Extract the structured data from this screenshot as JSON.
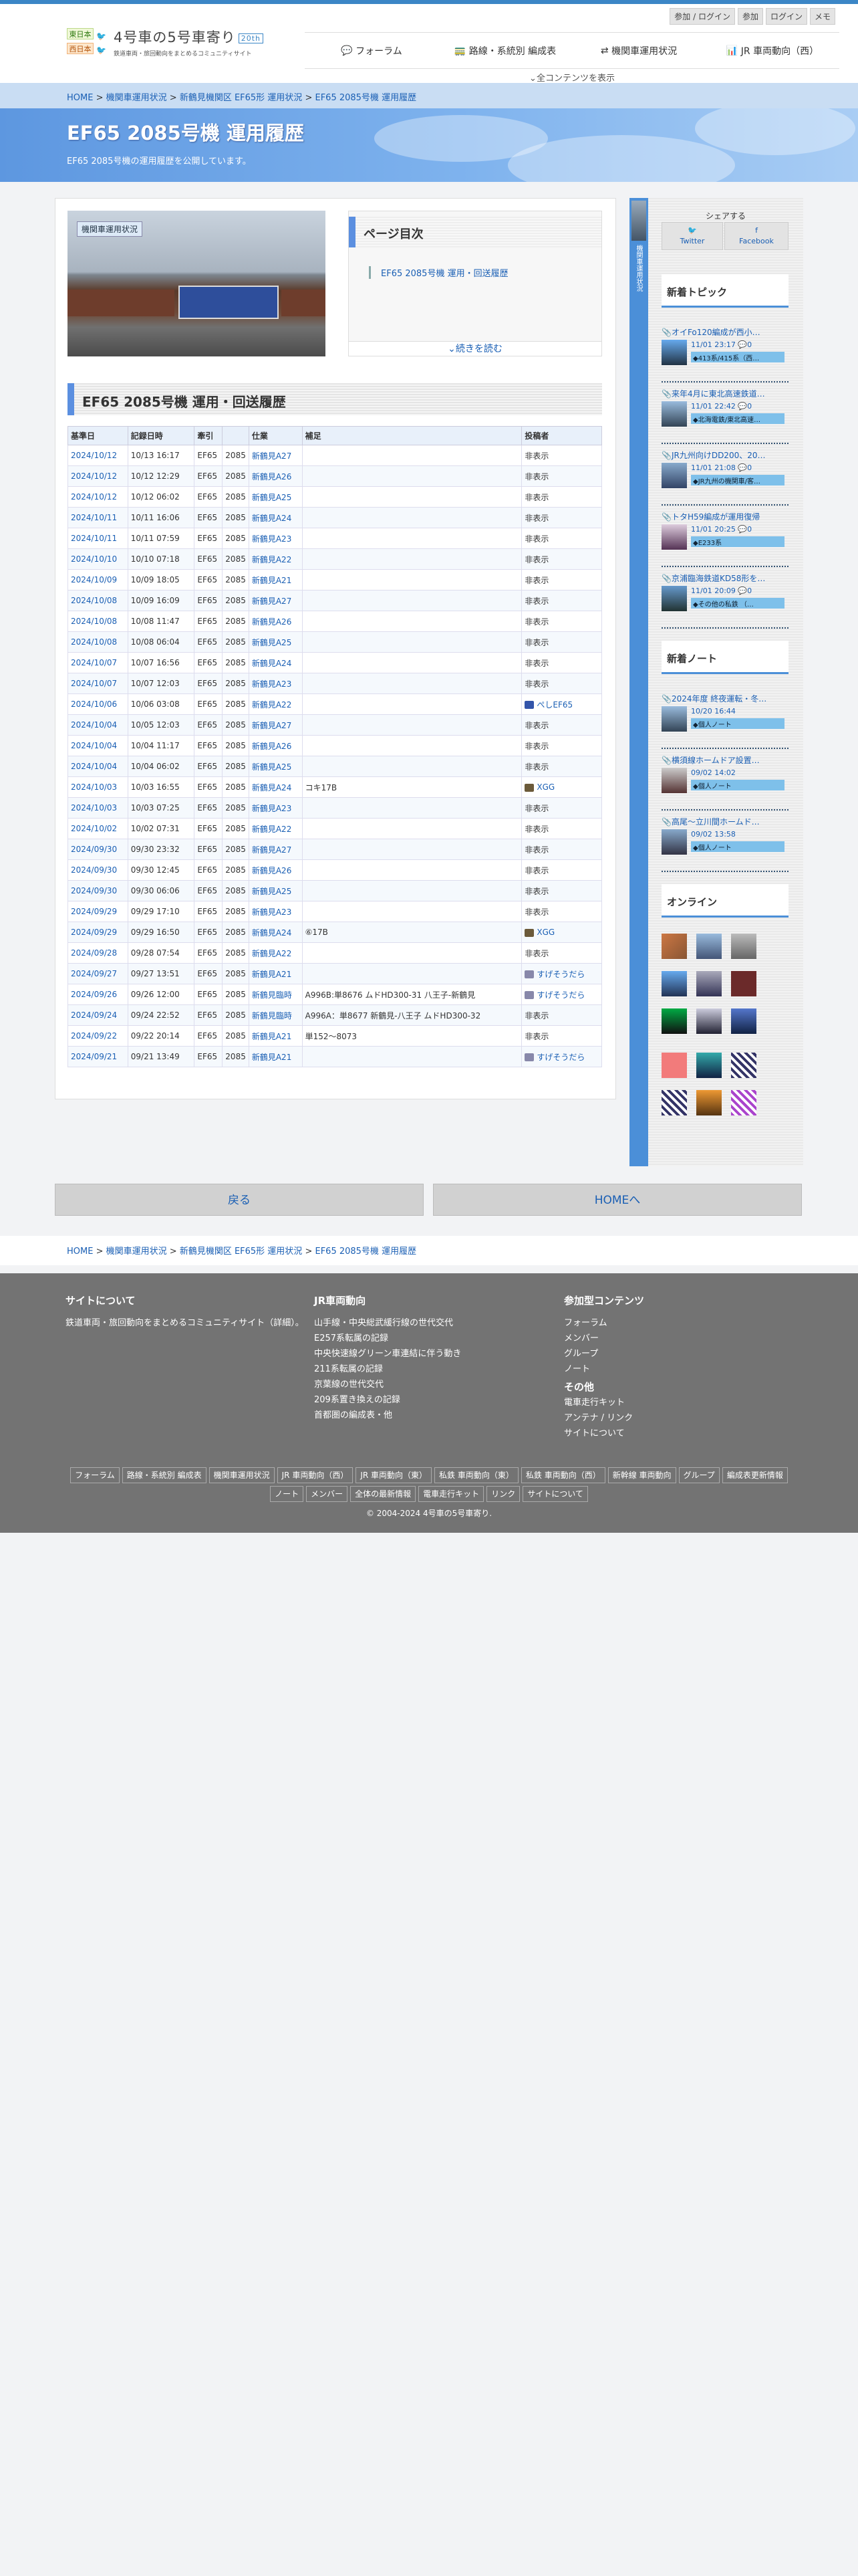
{
  "site": {
    "badge_east": "東日本",
    "badge_west": "西日本",
    "title": "4号車の5号車寄り",
    "title_badge": "20th",
    "subtitle": "鉄道車両・旅回動向をまとめるコミュニティサイト"
  },
  "top_links": [
    "参加 / ログイン",
    "参加",
    "ログイン",
    "メモ"
  ],
  "gnav": [
    "フォーラム",
    "路線・系統別 編成表",
    "機関車運用状況",
    "JR 車両動向（西）"
  ],
  "gnav_more": "全コンテンツを表示",
  "breadcrumb": {
    "home": "HOME",
    "sep": " > ",
    "l1": "機関車運用状況",
    "l2": "新鶴見機関区 EF65形 運用状況",
    "l3": "EF65 2085号機 運用履歴"
  },
  "hero": {
    "title": "EF65 2085号機 運用履歴",
    "desc": "EF65 2085号機の運用履歴を公開しています。"
  },
  "photo_category": "機関車運用状況",
  "toc": {
    "title": "ページ目次",
    "item": "EF65 2085号機 運用・回送履歴",
    "more": "続きを読む"
  },
  "section_title": "EF65 2085号機 運用・回送履歴",
  "table": {
    "headers": [
      "基準日",
      "記録日時",
      "牽引",
      "",
      "仕業",
      "補足",
      "投稿者"
    ],
    "rows": [
      [
        "2024/10/12",
        "10/13 16:17",
        "EF65",
        "2085",
        "新鶴見A27",
        "",
        "非表示"
      ],
      [
        "2024/10/12",
        "10/12 12:29",
        "EF65",
        "2085",
        "新鶴見A26",
        "",
        "非表示"
      ],
      [
        "2024/10/12",
        "10/12 06:02",
        "EF65",
        "2085",
        "新鶴見A25",
        "",
        "非表示"
      ],
      [
        "2024/10/11",
        "10/11 16:06",
        "EF65",
        "2085",
        "新鶴見A24",
        "",
        "非表示"
      ],
      [
        "2024/10/11",
        "10/11 07:59",
        "EF65",
        "2085",
        "新鶴見A23",
        "",
        "非表示"
      ],
      [
        "2024/10/10",
        "10/10 07:18",
        "EF65",
        "2085",
        "新鶴見A22",
        "",
        "非表示"
      ],
      [
        "2024/10/09",
        "10/09 18:05",
        "EF65",
        "2085",
        "新鶴見A21",
        "",
        "非表示"
      ],
      [
        "2024/10/08",
        "10/09 16:09",
        "EF65",
        "2085",
        "新鶴見A27",
        "",
        "非表示"
      ],
      [
        "2024/10/08",
        "10/08 11:47",
        "EF65",
        "2085",
        "新鶴見A26",
        "",
        "非表示"
      ],
      [
        "2024/10/08",
        "10/08 06:04",
        "EF65",
        "2085",
        "新鶴見A25",
        "",
        "非表示"
      ],
      [
        "2024/10/07",
        "10/07 16:56",
        "EF65",
        "2085",
        "新鶴見A24",
        "",
        "非表示"
      ],
      [
        "2024/10/07",
        "10/07 12:03",
        "EF65",
        "2085",
        "新鶴見A23",
        "",
        "非表示"
      ],
      [
        "2024/10/06",
        "10/06 03:08",
        "EF65",
        "2085",
        "新鶴見A22",
        "",
        "ぺしEF65"
      ],
      [
        "2024/10/04",
        "10/05 12:03",
        "EF65",
        "2085",
        "新鶴見A27",
        "",
        "非表示"
      ],
      [
        "2024/10/04",
        "10/04 11:17",
        "EF65",
        "2085",
        "新鶴見A26",
        "",
        "非表示"
      ],
      [
        "2024/10/04",
        "10/04 06:02",
        "EF65",
        "2085",
        "新鶴見A25",
        "",
        "非表示"
      ],
      [
        "2024/10/03",
        "10/03 16:55",
        "EF65",
        "2085",
        "新鶴見A24",
        "コキ17B",
        "XGG"
      ],
      [
        "2024/10/03",
        "10/03 07:25",
        "EF65",
        "2085",
        "新鶴見A23",
        "",
        "非表示"
      ],
      [
        "2024/10/02",
        "10/02 07:31",
        "EF65",
        "2085",
        "新鶴見A22",
        "",
        "非表示"
      ],
      [
        "2024/09/30",
        "09/30 23:32",
        "EF65",
        "2085",
        "新鶴見A27",
        "",
        "非表示"
      ],
      [
        "2024/09/30",
        "09/30 12:45",
        "EF65",
        "2085",
        "新鶴見A26",
        "",
        "非表示"
      ],
      [
        "2024/09/30",
        "09/30 06:06",
        "EF65",
        "2085",
        "新鶴見A25",
        "",
        "非表示"
      ],
      [
        "2024/09/29",
        "09/29 17:10",
        "EF65",
        "2085",
        "新鶴見A23",
        "",
        "非表示"
      ],
      [
        "2024/09/29",
        "09/29 16:50",
        "EF65",
        "2085",
        "新鶴見A24",
        "⑥17B",
        "XGG"
      ],
      [
        "2024/09/28",
        "09/28 07:54",
        "EF65",
        "2085",
        "新鶴見A22",
        "",
        "非表示"
      ],
      [
        "2024/09/27",
        "09/27 13:51",
        "EF65",
        "2085",
        "新鶴見A21",
        "",
        "すげそうだら"
      ],
      [
        "2024/09/26",
        "09/26 12:00",
        "EF65",
        "2085",
        "新鶴見臨時",
        "A996B:単8676 ムドHD300-31 八王子-新鶴見",
        "すげそうだら"
      ],
      [
        "2024/09/24",
        "09/24 22:52",
        "EF65",
        "2085",
        "新鶴見臨時",
        "A996A：単8677 新鶴見-八王子 ムドHD300-32",
        "非表示"
      ],
      [
        "2024/09/22",
        "09/22 20:14",
        "EF65",
        "2085",
        "新鶴見A21",
        "単152〜8073",
        "非表示"
      ],
      [
        "2024/09/21",
        "09/21 13:49",
        "EF65",
        "2085",
        "新鶴見A21",
        "",
        "すげそうだら"
      ]
    ]
  },
  "sidebar": {
    "tab_label": "機関車運用状況",
    "share_title": "シェアする",
    "share_twitter": "Twitter",
    "share_facebook": "Facebook",
    "new_topics_title": "新着トピック",
    "topics": [
      {
        "title": "オイFo120編成が西小…",
        "meta": "11/01 23:17 💬0",
        "tag": "413系/415系（西…"
      },
      {
        "title": "来年4月に東北高速鉄道…",
        "meta": "11/01 22:42 💬0",
        "tag": "北海電鉄/東北高速…"
      },
      {
        "title": "JR九州向けDD200、20…",
        "meta": "11/01 21:08 💬0",
        "tag": "JR九州の機関車/客…"
      },
      {
        "title": "トタH59編成が運用復帰",
        "meta": "11/01 20:25 💬0",
        "tag": "E233系"
      },
      {
        "title": "京浦臨海鉄道KD58形を…",
        "meta": "11/01 20:09 💬0",
        "tag": "その他の私鉄 （…"
      }
    ],
    "new_notes_title": "新着ノート",
    "notes": [
      {
        "title": "2024年度 終夜運転・冬…",
        "meta": "10/20 16:44",
        "tag": "個人ノート"
      },
      {
        "title": "横須線ホームドア設置…",
        "meta": "09/02 14:02",
        "tag": "個人ノート"
      },
      {
        "title": "高尾〜立川間ホームド…",
        "meta": "09/02 13:58",
        "tag": "個人ノート"
      }
    ],
    "online_title": "オンライン"
  },
  "buttons": {
    "back": "戻る",
    "home": "HOMEへ"
  },
  "footer": {
    "about_title": "サイトについて",
    "about_text": "鉄道車両・旅回動向をまとめるコミュニティサイト（詳細）。",
    "jr_title": "JR車両動向",
    "jr_items": [
      "山手線・中央総武緩行線の世代交代",
      "E257系転属の記録",
      "中央快速線グリーン車連結に伴う動き",
      "211系転属の記録",
      "京葉線の世代交代",
      "209系置き換えの記録",
      "首都圏の編成表・他"
    ],
    "join_title": "参加型コンテンツ",
    "join_items": [
      "フォーラム",
      "メンバー",
      "グループ",
      "ノート"
    ],
    "other_title": "その他",
    "other_items": [
      "電車走行キット",
      "アンテナ / リンク",
      "サイトについて"
    ],
    "links": [
      "フォーラム",
      "路線・系統別 編成表",
      "機関車運用状況",
      "JR 車両動向（西）",
      "JR 車両動向（東）",
      "私鉄 車両動向（東）",
      "私鉄 車両動向（西）",
      "新幹線 車両動向",
      "グループ",
      "編成表更新情報",
      "ノート",
      "メンバー",
      "全体の最新情報",
      "電車走行キット",
      "リンク",
      "サイトについて"
    ],
    "copyright": "© 2004-2024 4号車の5号車寄り."
  }
}
